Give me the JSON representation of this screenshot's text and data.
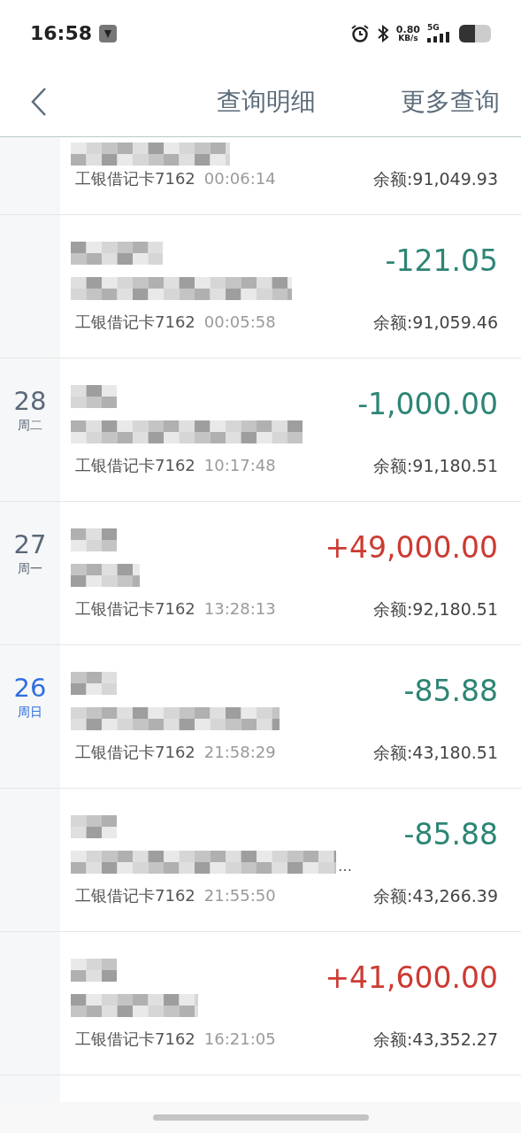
{
  "status_bar": {
    "time": "16:58",
    "net_speed_value": "0.80",
    "net_speed_unit": "KB/s",
    "network": "5G"
  },
  "header": {
    "title": "查询明细",
    "action": "更多查询"
  },
  "rows": [
    {
      "card": "工银借记卡7162",
      "time": "00:06:14",
      "balance": "余额:91,049.93"
    },
    {
      "kind": "expense",
      "amount": "-121.05",
      "card": "工银借记卡7162",
      "time": "00:05:58",
      "balance": "余额:91,059.46"
    },
    {
      "date": {
        "day": "28",
        "weekday": "周二",
        "highlighted": false
      },
      "kind": "expense",
      "amount": "-1,000.00",
      "card": "工银借记卡7162",
      "time": "10:17:48",
      "balance": "余额:91,180.51"
    },
    {
      "date": {
        "day": "27",
        "weekday": "周一",
        "highlighted": false
      },
      "kind": "income",
      "amount": "+49,000.00",
      "card": "工银借记卡7162",
      "time": "13:28:13",
      "balance": "余额:92,180.51"
    },
    {
      "date": {
        "day": "26",
        "weekday": "周日",
        "highlighted": true
      },
      "kind": "expense",
      "amount": "-85.88",
      "card": "工银借记卡7162",
      "time": "21:58:29",
      "balance": "余额:43,180.51"
    },
    {
      "kind": "expense",
      "amount": "-85.88",
      "ellipsis": "…",
      "card": "工银借记卡7162",
      "time": "21:55:50",
      "balance": "余额:43,266.39"
    },
    {
      "kind": "income",
      "amount": "+41,600.00",
      "card": "工银借记卡7162",
      "time": "16:21:05",
      "balance": "余额:43,352.27"
    }
  ]
}
